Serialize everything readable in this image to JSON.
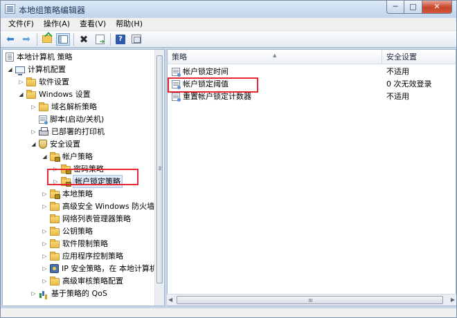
{
  "window": {
    "title": "本地组策略编辑器",
    "minimize": "─",
    "maximize": "□",
    "close": "✕"
  },
  "menu": [
    "文件(F)",
    "操作(A)",
    "查看(V)",
    "帮助(H)"
  ],
  "toolbar": {
    "back": "⬅",
    "forward": "➡",
    "delete": "✖",
    "help": "?"
  },
  "tree": {
    "items": [
      {
        "label": "本地计算机 策略",
        "icon": "doc-icon",
        "expander": ""
      },
      {
        "label": "计算机配置",
        "icon": "computer-icon",
        "expander": "◢"
      },
      {
        "label": "软件设置",
        "icon": "folder-icon",
        "expander": "▷"
      },
      {
        "label": "Windows 设置",
        "icon": "folder-icon",
        "expander": "◢"
      },
      {
        "label": "域名解析策略",
        "icon": "folder-icon",
        "expander": "▷"
      },
      {
        "label": "脚本(启动/关机)",
        "icon": "script-icon",
        "expander": ""
      },
      {
        "label": "已部署的打印机",
        "icon": "printer-icon",
        "expander": "▷"
      },
      {
        "label": "安全设置",
        "icon": "shield-icon",
        "expander": "◢"
      },
      {
        "label": "帐户策略",
        "icon": "lock-folder-icon",
        "expander": "◢"
      },
      {
        "label": "密码策略",
        "icon": "lock-folder-icon",
        "expander": "▷"
      },
      {
        "label": "帐户锁定策略",
        "icon": "lock-folder-icon",
        "expander": "▷"
      },
      {
        "label": "本地策略",
        "icon": "lock-folder-icon",
        "expander": "▷"
      },
      {
        "label": "高级安全 Windows 防火墙",
        "icon": "folder-icon",
        "expander": "▷"
      },
      {
        "label": "网络列表管理器策略",
        "icon": "folder-icon",
        "expander": ""
      },
      {
        "label": "公钥策略",
        "icon": "folder-icon",
        "expander": "▷"
      },
      {
        "label": "软件限制策略",
        "icon": "folder-icon",
        "expander": "▷"
      },
      {
        "label": "应用程序控制策略",
        "icon": "folder-icon",
        "expander": "▷"
      },
      {
        "label": "IP 安全策略，在 本地计算机",
        "icon": "ipsec-icon",
        "expander": "▷"
      },
      {
        "label": "高级审核策略配置",
        "icon": "folder-icon",
        "expander": "▷"
      },
      {
        "label": "基于策略的 QoS",
        "icon": "chart-icon",
        "expander": "▷"
      }
    ],
    "selected": "帐户锁定策略"
  },
  "table": {
    "headers": [
      "策略",
      "安全设置"
    ],
    "rows": [
      {
        "policy": "帐户锁定时间",
        "setting": "不适用"
      },
      {
        "policy": "帐户锁定阈值",
        "setting": "0 次无效登录"
      },
      {
        "policy": "重置帐户锁定计数器",
        "setting": "不适用"
      }
    ]
  },
  "colors": {
    "highlight_box": "#e8242e",
    "selection": "#dbe8f7"
  }
}
